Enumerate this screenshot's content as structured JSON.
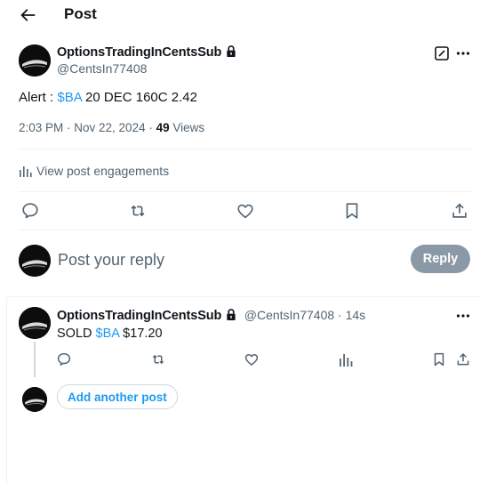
{
  "header": {
    "title": "Post",
    "back_icon": "arrow-left-icon"
  },
  "main_post": {
    "author_name": "OptionsTradingInCentsSub",
    "author_handle": "@CentsIn77408",
    "text_prefix": "Alert : ",
    "cashtag": "$BA",
    "text_suffix": " 20 DEC 160C 2.42",
    "timestamp": "2:03 PM · Nov 22, 2024 · ",
    "view_count": "49",
    "views_label": " Views",
    "engagements_label": "View post engagements"
  },
  "reply_box": {
    "placeholder": "Post your reply",
    "button_label": "Reply"
  },
  "reply_post": {
    "author_name": "OptionsTradingInCentsSub",
    "author_handle": "@CentsIn77408",
    "time": " · 14s",
    "text_prefix": "SOLD ",
    "cashtag": "$BA",
    "text_suffix": " $17.20"
  },
  "add_post_label": "Add another post",
  "colors": {
    "accent": "#1d9bf0",
    "text": "#0f1419",
    "muted": "#536471",
    "reply_button": "#8b98a5"
  }
}
